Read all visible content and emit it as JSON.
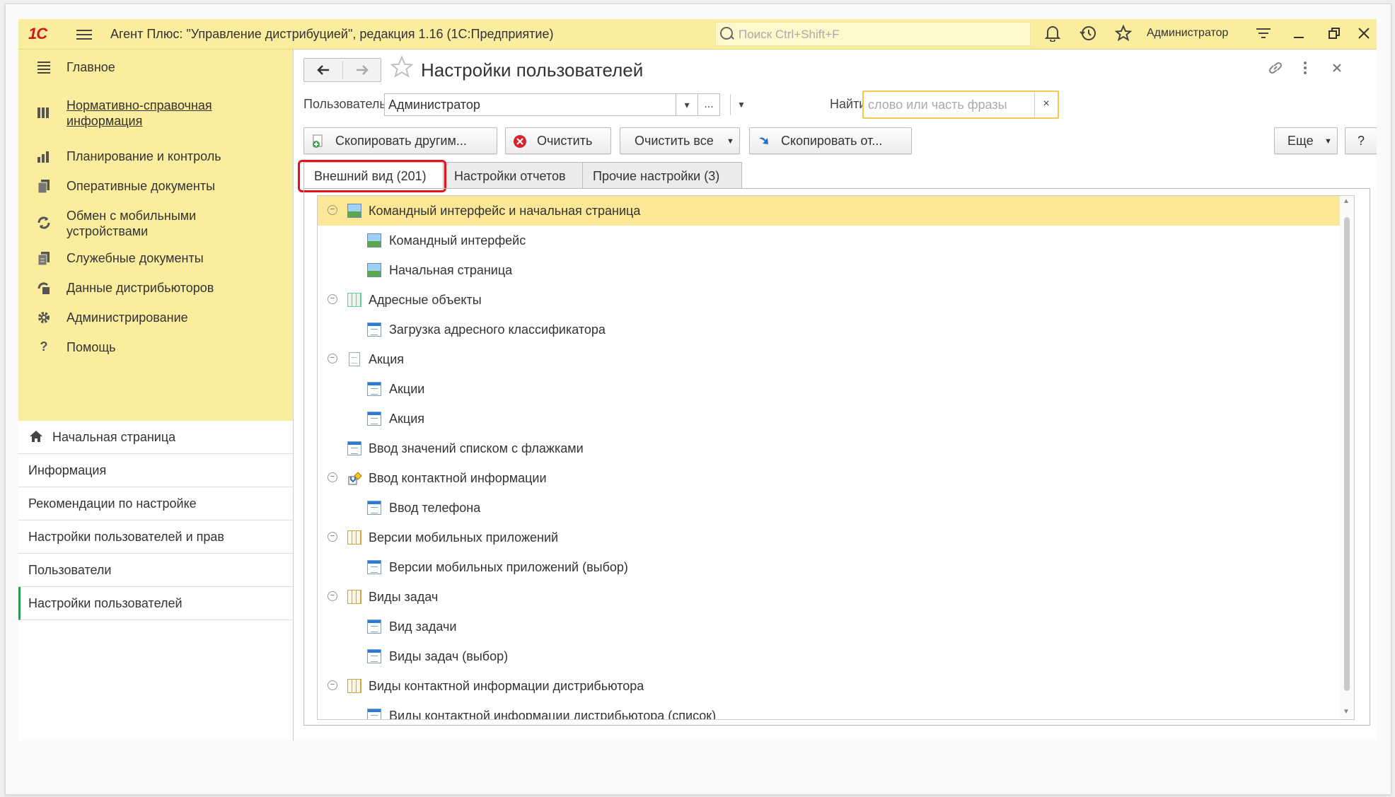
{
  "app": {
    "logo": "1С",
    "title": "Агент Плюс: \"Управление дистрибуцией\", редакция 1.16  (1С:Предприятие)",
    "search_placeholder": "Поиск Ctrl+Shift+F",
    "user": "Администратор"
  },
  "sidebar": {
    "sections": [
      {
        "label": "Главное",
        "icon": "hamburger-icon"
      },
      {
        "label": "Нормативно-справочная информация",
        "icon": "books-icon"
      },
      {
        "label": "Планирование и контроль",
        "icon": "chart-icon"
      },
      {
        "label": "Оперативные документы",
        "icon": "documents-icon"
      },
      {
        "label": "Обмен с мобильными устройствами",
        "icon": "sync-icon"
      },
      {
        "label": "Служебные документы",
        "icon": "service-docs-icon"
      },
      {
        "label": "Данные дистрибьюторов",
        "icon": "distributor-icon"
      },
      {
        "label": "Администрирование",
        "icon": "gear-icon"
      },
      {
        "label": "Помощь",
        "icon": "help-icon"
      }
    ],
    "pages": [
      {
        "label": "Начальная страница",
        "icon": "home-icon"
      },
      {
        "label": "Информация"
      },
      {
        "label": "Рекомендации по настройке"
      },
      {
        "label": "Настройки пользователей и прав"
      },
      {
        "label": "Пользователи"
      },
      {
        "label": "Настройки пользователей",
        "active": true
      }
    ]
  },
  "form": {
    "title": "Настройки пользователей",
    "user_label": "Пользователь:",
    "user_value": "Администратор",
    "ellipsis": "...",
    "find_label": "Найти:",
    "find_placeholder": "слово или часть фразы",
    "clear_x": "×",
    "buttons": {
      "copy_to_others": "Скопировать другим...",
      "clear": "Очистить",
      "clear_all": "Очистить все",
      "copy_from": "Скопировать от...",
      "more": "Еще",
      "help": "?"
    },
    "tabs": [
      {
        "label": "Внешний вид (201)",
        "active": true
      },
      {
        "label": "Настройки отчетов"
      },
      {
        "label": "Прочие настройки (3)"
      }
    ],
    "tree": [
      {
        "label": "Командный интерфейс и начальная страница",
        "level": 0,
        "expanded": true,
        "icon": "picture-icon",
        "selected": true
      },
      {
        "label": "Командный интерфейс",
        "level": 1,
        "icon": "picture-icon"
      },
      {
        "label": "Начальная страница",
        "level": 1,
        "icon": "picture-icon"
      },
      {
        "label": "Адресные объекты",
        "level": 0,
        "expanded": true,
        "icon": "grid-icon"
      },
      {
        "label": "Загрузка адресного классификатора",
        "level": 1,
        "icon": "form-icon"
      },
      {
        "label": "Акция",
        "level": 0,
        "expanded": true,
        "icon": "page-icon"
      },
      {
        "label": "Акции",
        "level": 1,
        "icon": "form-icon"
      },
      {
        "label": "Акция",
        "level": 1,
        "icon": "form-icon"
      },
      {
        "label": "Ввод значений списком с флажками",
        "level": 0,
        "expanded": false,
        "icon": "form-icon"
      },
      {
        "label": "Ввод контактной информации",
        "level": 0,
        "expanded": true,
        "icon": "contact-icon"
      },
      {
        "label": "Ввод телефона",
        "level": 1,
        "icon": "form-icon"
      },
      {
        "label": "Версии мобильных приложений",
        "level": 0,
        "expanded": true,
        "icon": "table-icon"
      },
      {
        "label": "Версии мобильных приложений (выбор)",
        "level": 1,
        "icon": "form-icon"
      },
      {
        "label": "Виды задач",
        "level": 0,
        "expanded": true,
        "icon": "table-icon"
      },
      {
        "label": "Вид задачи",
        "level": 1,
        "icon": "form-icon"
      },
      {
        "label": "Виды задач (выбор)",
        "level": 1,
        "icon": "form-icon"
      },
      {
        "label": "Виды контактной информации дистрибьютора",
        "level": 0,
        "expanded": true,
        "icon": "table-icon"
      },
      {
        "label": "Виды контактной информации дистрибьютора (список)",
        "level": 1,
        "icon": "form-icon"
      }
    ]
  },
  "colors": {
    "accent_yellow": "#fbed9e",
    "selected_row": "#fbe796",
    "highlight_red": "#e0141b",
    "active_green": "#2f9a4b"
  }
}
